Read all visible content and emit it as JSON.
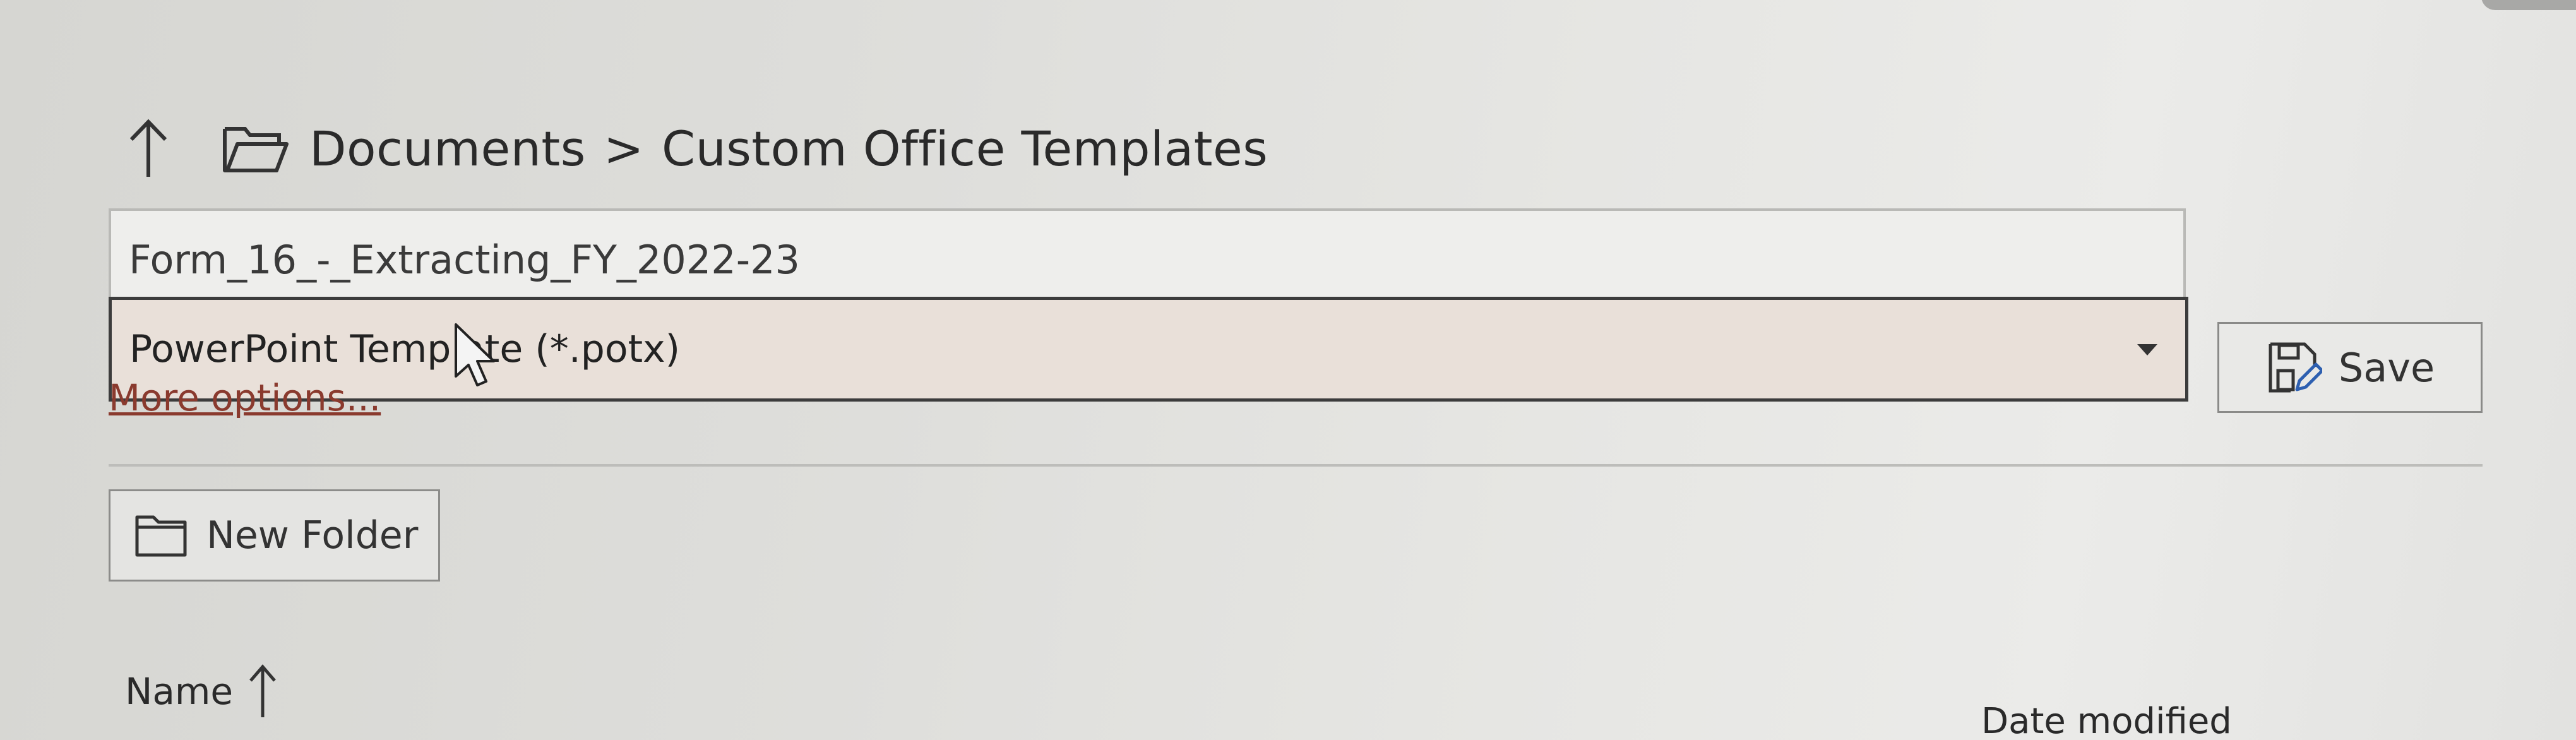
{
  "breadcrumb": {
    "items": [
      "Documents",
      "Custom Office Templates"
    ],
    "separator": ">"
  },
  "filename": {
    "value": "Form_16_-_Extracting_FY_2022-23"
  },
  "save_as_type": {
    "selected": "PowerPoint Template (*.potx)"
  },
  "links": {
    "more_options": "More options..."
  },
  "buttons": {
    "save": "Save",
    "new_folder": "New Folder"
  },
  "columns": {
    "name": "Name",
    "date_modified": "Date modified"
  },
  "icons": {
    "up": "arrow-up-icon",
    "folder": "folder-open-icon",
    "save": "save-icon",
    "new_folder": "folder-icon",
    "sort": "sort-ascending-icon",
    "dropdown": "chevron-down-icon"
  },
  "colors": {
    "link": "#8a3a2e",
    "select_background": "#e9e0d9"
  }
}
